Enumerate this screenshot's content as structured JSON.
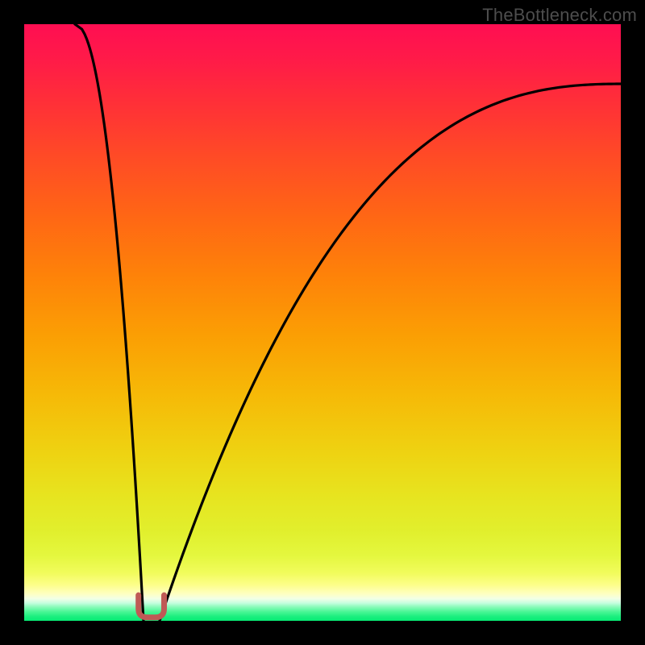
{
  "watermark": {
    "text": "TheBottleneck.com"
  },
  "gradient": {
    "stops": [
      {
        "offset": 0.0,
        "color": "#ff0e52"
      },
      {
        "offset": 0.06,
        "color": "#ff1b48"
      },
      {
        "offset": 0.13,
        "color": "#ff2f38"
      },
      {
        "offset": 0.22,
        "color": "#ff4a26"
      },
      {
        "offset": 0.32,
        "color": "#ff6615"
      },
      {
        "offset": 0.42,
        "color": "#fe8209"
      },
      {
        "offset": 0.52,
        "color": "#fb9e04"
      },
      {
        "offset": 0.62,
        "color": "#f6b907"
      },
      {
        "offset": 0.72,
        "color": "#eed312"
      },
      {
        "offset": 0.79,
        "color": "#e7e41f"
      },
      {
        "offset": 0.85,
        "color": "#e1ef2d"
      },
      {
        "offset": 0.89,
        "color": "#e4f73e"
      },
      {
        "offset": 0.92,
        "color": "#f1fc5c"
      },
      {
        "offset": 0.94,
        "color": "#fdfe8a"
      },
      {
        "offset": 0.955,
        "color": "#feffc2"
      },
      {
        "offset": 0.963,
        "color": "#f1ffe6"
      },
      {
        "offset": 0.97,
        "color": "#c7fee0"
      },
      {
        "offset": 0.977,
        "color": "#87fbb8"
      },
      {
        "offset": 0.985,
        "color": "#48f695"
      },
      {
        "offset": 0.993,
        "color": "#1aef7e"
      },
      {
        "offset": 1.0,
        "color": "#07eb74"
      }
    ]
  },
  "marker": {
    "x_frac": 0.213,
    "color": "#bf5a56",
    "width_frac": 0.043,
    "height_frac": 0.043,
    "corner_r_frac": 0.015,
    "stroke_w": 7
  },
  "curves": {
    "stroke": "#000000",
    "stroke_w": 3.2,
    "left": {
      "top_x_frac": 0.085,
      "bottom_x_frac": 0.2,
      "exponent": 2.1
    },
    "right": {
      "top_x_frac": 1.01,
      "top_y_frac": 0.1,
      "bottom_x_frac": 0.227,
      "exponent": 2.6
    }
  },
  "chart_data": {
    "type": "line",
    "title": "",
    "xlabel": "",
    "ylabel": "",
    "x_range": [
      0,
      1
    ],
    "y_range": [
      0,
      1
    ],
    "notch_x": 0.213,
    "series": [
      {
        "name": "left-branch",
        "x": [
          0.085,
          0.097,
          0.108,
          0.12,
          0.131,
          0.143,
          0.154,
          0.166,
          0.177,
          0.189,
          0.2
        ],
        "y": [
          1.0,
          0.787,
          0.609,
          0.463,
          0.345,
          0.25,
          0.176,
          0.117,
          0.07,
          0.032,
          0.0
        ]
      },
      {
        "name": "right-branch",
        "x": [
          0.227,
          0.305,
          0.384,
          0.462,
          0.54,
          0.618,
          0.697,
          0.775,
          0.853,
          0.932,
          1.01
        ],
        "y": [
          0.0,
          0.207,
          0.375,
          0.51,
          0.617,
          0.702,
          0.768,
          0.819,
          0.857,
          0.884,
          0.9
        ]
      }
    ],
    "background_gradient": "vertical red→orange→yellow→pale→green",
    "marker": {
      "x": 0.213,
      "y": 0.0,
      "shape": "rounded-U",
      "color": "#bf5a56"
    },
    "watermark": "TheBottleneck.com"
  }
}
